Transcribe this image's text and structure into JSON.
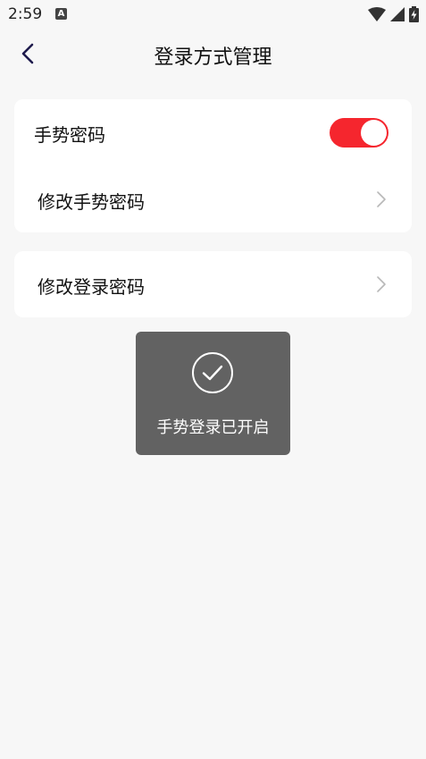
{
  "status_bar": {
    "time": "2:59",
    "notification_icon_letter": "A",
    "icons": [
      "wifi-icon",
      "cell-signal-icon",
      "battery-charging-icon"
    ]
  },
  "header": {
    "title": "登录方式管理",
    "back_icon": "chevron-left-icon"
  },
  "gesture_card": {
    "toggle_label": "手势密码",
    "toggle_on": true,
    "toggle_color": "#f5262e",
    "modify_label": "修改手势密码"
  },
  "login_card": {
    "modify_label": "修改登录密码"
  },
  "toast": {
    "icon": "check-circle-icon",
    "message": "手势登录已开启"
  }
}
